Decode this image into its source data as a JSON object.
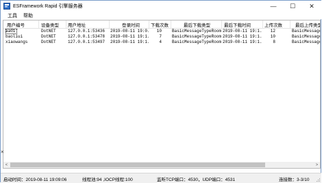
{
  "window": {
    "title": "ESFramework Rapid 引擎服务器",
    "icon": "app-icon",
    "controls": {
      "minimize": "—",
      "maximize": "☐",
      "close": "✕"
    }
  },
  "menu": {
    "items": [
      "工具",
      "帮助"
    ]
  },
  "table": {
    "columns": [
      "用户编号",
      "设备类型",
      "用户地址",
      "登录时间",
      "下载次数",
      "最后下载类型",
      "最后下载时间",
      "上传次数",
      "最后上传类型"
    ],
    "rows": [
      [
        "aa01",
        "DotNET",
        "127.0.0.1:53436",
        "2019-08-11 19:0...",
        "10",
        "BasicMessageTypeRoom...",
        "2019-08-11 19:1...",
        "12",
        "BasicMessageTypeRo"
      ],
      [
        "baoliui",
        "DotNET",
        "127.0.0.1:53478",
        "2019-08-11 19:1...",
        "7",
        "BasicMessageTypeRoom...",
        "2019-08-11 19:1...",
        "10",
        "BasicMessageTypeRo"
      ],
      [
        "xiaowangs",
        "DotNET",
        "127.0.0.1:53497",
        "2019-08-11 19:1...",
        "4",
        "BasicMessageTypeRoom...",
        "2019-08-11 19:1...",
        "8",
        "BasicMessageTypeRo"
      ]
    ]
  },
  "scrollbar": {
    "left_arrow": "<",
    "right_arrow": ">"
  },
  "status": {
    "start_time": "启动时间：2019-08-11 19:09:06",
    "threads": "线程池:94 ,IOCP线程:100",
    "ports": "监听TCP端口：4530，UDP端口：4531",
    "connections": "连接数：3-3/10"
  },
  "edge_marker": "×"
}
